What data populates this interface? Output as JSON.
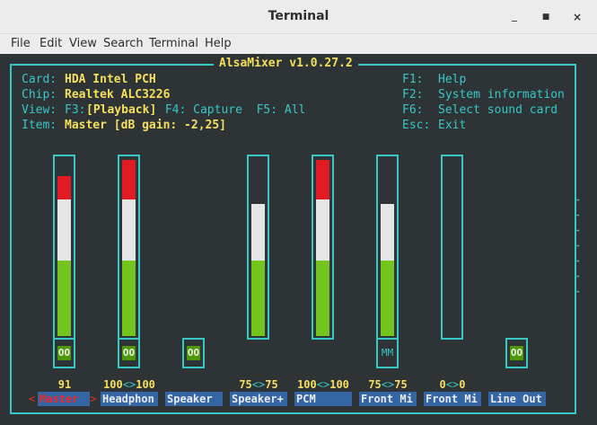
{
  "window": {
    "title": "Terminal",
    "min_icon": "_",
    "max_icon": "■",
    "close_icon": "×"
  },
  "menu": [
    "File",
    "Edit",
    "View",
    "Search",
    "Terminal",
    "Help"
  ],
  "app_title": "AlsaMixer v1.0.27.2",
  "info": {
    "card_label": "Card:",
    "card_value": "HDA Intel PCH",
    "chip_label": "Chip:",
    "chip_value": "Realtek ALC3226",
    "view_label": "View:",
    "view_f3": "F3:",
    "view_playback": "[Playback]",
    "view_rest": " F4: Capture  F5: All",
    "item_label": "Item:",
    "item_value": "Master [dB gain: -2,25]"
  },
  "keys": [
    {
      "key": "F1:",
      "desc": "Help"
    },
    {
      "key": "F2:",
      "desc": "System information"
    },
    {
      "key": "F6:",
      "desc": "Select sound card"
    },
    {
      "key": "Esc:",
      "desc": "Exit"
    }
  ],
  "channels": [
    {
      "name": "Master",
      "has_bar": true,
      "level": 0.91,
      "switch": "OO",
      "level_left": "91",
      "level_right": "",
      "selected": true
    },
    {
      "name": "Headphon",
      "has_bar": true,
      "level": 1.0,
      "switch": "OO",
      "level_left": "100",
      "level_right": "100",
      "selected": false
    },
    {
      "name": "Speaker",
      "has_bar": false,
      "level": 0,
      "switch": "OO",
      "level_left": "",
      "level_right": "",
      "selected": false
    },
    {
      "name": "Speaker+",
      "has_bar": true,
      "level": 0.75,
      "switch": "",
      "level_left": "75",
      "level_right": "75",
      "selected": false
    },
    {
      "name": "PCM",
      "has_bar": true,
      "level": 1.0,
      "switch": "",
      "level_left": "100",
      "level_right": "100",
      "selected": false
    },
    {
      "name": "Front Mi",
      "has_bar": true,
      "level": 0.75,
      "switch": "MM",
      "level_left": "75",
      "level_right": "75",
      "selected": false
    },
    {
      "name": "Front Mi",
      "has_bar": true,
      "level": 0,
      "switch": "",
      "level_left": "0",
      "level_right": "0",
      "selected": false
    },
    {
      "name": "Line Out",
      "has_bar": false,
      "level": 0,
      "switch": "OO",
      "level_left": "",
      "level_right": "",
      "selected": false
    }
  ],
  "level_separator": "<>",
  "selected_markers": [
    "<",
    ">"
  ],
  "more_arrow": "→",
  "colors": {
    "frame": "#36c7c7",
    "text_value": "#f6df5c",
    "bar_green": "#73c41d",
    "bar_white": "#e6e6e6",
    "bar_red": "#e01b24",
    "name_bg": "#3465a4",
    "selected_name": "#ef2929"
  }
}
